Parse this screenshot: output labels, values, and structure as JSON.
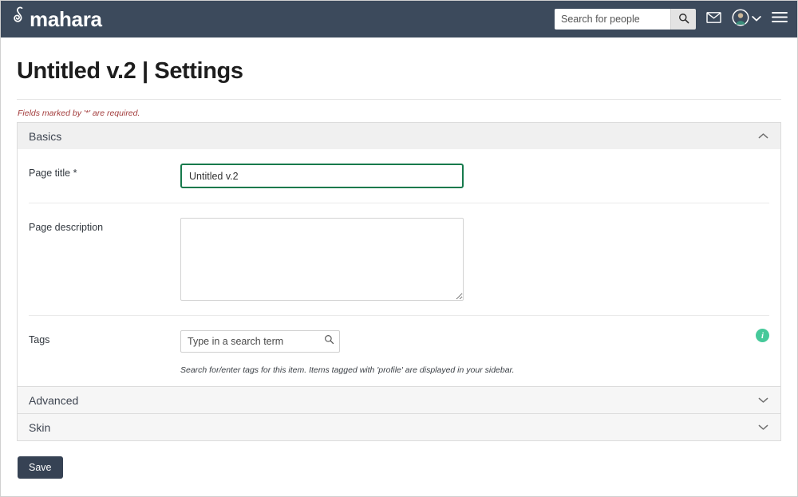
{
  "header": {
    "brand_text": "mahara",
    "brand_icon": "mahara-loop-logo",
    "search": {
      "placeholder": "Search for people",
      "value": "",
      "button_icon": "search-icon"
    },
    "icons": {
      "mail": "envelope-icon",
      "avatar": "user-avatar-icon",
      "avatar_caret": "chevron-down-icon",
      "menu": "hamburger-menu-icon"
    }
  },
  "page": {
    "title": "Untitled v.2 | Settings",
    "required_note": "Fields marked by '*' are required."
  },
  "panels": [
    {
      "id": "basics",
      "label": "Basics",
      "expanded": true,
      "chevron": "chevron-up-icon"
    },
    {
      "id": "advanced",
      "label": "Advanced",
      "expanded": false,
      "chevron": "chevron-down-icon"
    },
    {
      "id": "skin",
      "label": "Skin",
      "expanded": false,
      "chevron": "chevron-down-icon"
    }
  ],
  "form": {
    "page_title": {
      "label": "Page title",
      "required_marker": "*",
      "value": "Untitled v.2",
      "placeholder": "",
      "focused": true,
      "focus_color": "#167a4c"
    },
    "page_description": {
      "label": "Page description",
      "value": "",
      "placeholder": ""
    },
    "tags": {
      "label": "Tags",
      "value": "",
      "placeholder": "Type in a search term",
      "search_icon": "search-icon",
      "help_text": "Search for/enter tags for this item. Items tagged with 'profile' are displayed in your sidebar.",
      "info_icon": "info-icon",
      "info_icon_letter": "i",
      "info_color": "#46c99a"
    }
  },
  "actions": {
    "save_label": "Save"
  },
  "colors": {
    "header_bg": "#3c4a5c",
    "save_bg": "#364254",
    "required_note": "#a23b3b",
    "panel_head_bg": "#f6f6f6"
  }
}
